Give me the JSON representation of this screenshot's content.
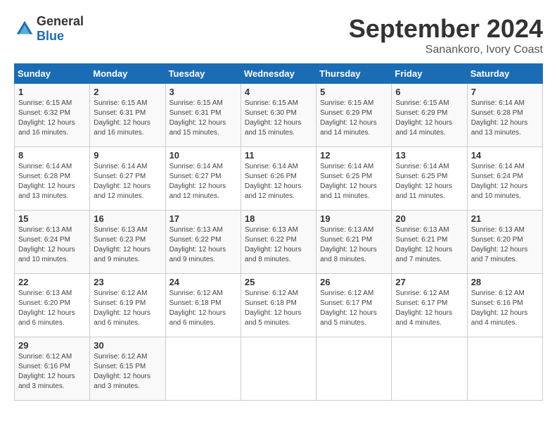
{
  "header": {
    "logo_line1": "General",
    "logo_line2": "Blue",
    "month": "September 2024",
    "location": "Sanankoro, Ivory Coast"
  },
  "days_of_week": [
    "Sunday",
    "Monday",
    "Tuesday",
    "Wednesday",
    "Thursday",
    "Friday",
    "Saturday"
  ],
  "weeks": [
    [
      {
        "day": "1",
        "info": "Sunrise: 6:15 AM\nSunset: 6:32 PM\nDaylight: 12 hours\nand 16 minutes."
      },
      {
        "day": "2",
        "info": "Sunrise: 6:15 AM\nSunset: 6:31 PM\nDaylight: 12 hours\nand 16 minutes."
      },
      {
        "day": "3",
        "info": "Sunrise: 6:15 AM\nSunset: 6:31 PM\nDaylight: 12 hours\nand 15 minutes."
      },
      {
        "day": "4",
        "info": "Sunrise: 6:15 AM\nSunset: 6:30 PM\nDaylight: 12 hours\nand 15 minutes."
      },
      {
        "day": "5",
        "info": "Sunrise: 6:15 AM\nSunset: 6:29 PM\nDaylight: 12 hours\nand 14 minutes."
      },
      {
        "day": "6",
        "info": "Sunrise: 6:15 AM\nSunset: 6:29 PM\nDaylight: 12 hours\nand 14 minutes."
      },
      {
        "day": "7",
        "info": "Sunrise: 6:14 AM\nSunset: 6:28 PM\nDaylight: 12 hours\nand 13 minutes."
      }
    ],
    [
      {
        "day": "8",
        "info": "Sunrise: 6:14 AM\nSunset: 6:28 PM\nDaylight: 12 hours\nand 13 minutes."
      },
      {
        "day": "9",
        "info": "Sunrise: 6:14 AM\nSunset: 6:27 PM\nDaylight: 12 hours\nand 12 minutes."
      },
      {
        "day": "10",
        "info": "Sunrise: 6:14 AM\nSunset: 6:27 PM\nDaylight: 12 hours\nand 12 minutes."
      },
      {
        "day": "11",
        "info": "Sunrise: 6:14 AM\nSunset: 6:26 PM\nDaylight: 12 hours\nand 12 minutes."
      },
      {
        "day": "12",
        "info": "Sunrise: 6:14 AM\nSunset: 6:25 PM\nDaylight: 12 hours\nand 11 minutes."
      },
      {
        "day": "13",
        "info": "Sunrise: 6:14 AM\nSunset: 6:25 PM\nDaylight: 12 hours\nand 11 minutes."
      },
      {
        "day": "14",
        "info": "Sunrise: 6:14 AM\nSunset: 6:24 PM\nDaylight: 12 hours\nand 10 minutes."
      }
    ],
    [
      {
        "day": "15",
        "info": "Sunrise: 6:13 AM\nSunset: 6:24 PM\nDaylight: 12 hours\nand 10 minutes."
      },
      {
        "day": "16",
        "info": "Sunrise: 6:13 AM\nSunset: 6:23 PM\nDaylight: 12 hours\nand 9 minutes."
      },
      {
        "day": "17",
        "info": "Sunrise: 6:13 AM\nSunset: 6:22 PM\nDaylight: 12 hours\nand 9 minutes."
      },
      {
        "day": "18",
        "info": "Sunrise: 6:13 AM\nSunset: 6:22 PM\nDaylight: 12 hours\nand 8 minutes."
      },
      {
        "day": "19",
        "info": "Sunrise: 6:13 AM\nSunset: 6:21 PM\nDaylight: 12 hours\nand 8 minutes."
      },
      {
        "day": "20",
        "info": "Sunrise: 6:13 AM\nSunset: 6:21 PM\nDaylight: 12 hours\nand 7 minutes."
      },
      {
        "day": "21",
        "info": "Sunrise: 6:13 AM\nSunset: 6:20 PM\nDaylight: 12 hours\nand 7 minutes."
      }
    ],
    [
      {
        "day": "22",
        "info": "Sunrise: 6:13 AM\nSunset: 6:20 PM\nDaylight: 12 hours\nand 6 minutes."
      },
      {
        "day": "23",
        "info": "Sunrise: 6:12 AM\nSunset: 6:19 PM\nDaylight: 12 hours\nand 6 minutes."
      },
      {
        "day": "24",
        "info": "Sunrise: 6:12 AM\nSunset: 6:18 PM\nDaylight: 12 hours\nand 6 minutes."
      },
      {
        "day": "25",
        "info": "Sunrise: 6:12 AM\nSunset: 6:18 PM\nDaylight: 12 hours\nand 5 minutes."
      },
      {
        "day": "26",
        "info": "Sunrise: 6:12 AM\nSunset: 6:17 PM\nDaylight: 12 hours\nand 5 minutes."
      },
      {
        "day": "27",
        "info": "Sunrise: 6:12 AM\nSunset: 6:17 PM\nDaylight: 12 hours\nand 4 minutes."
      },
      {
        "day": "28",
        "info": "Sunrise: 6:12 AM\nSunset: 6:16 PM\nDaylight: 12 hours\nand 4 minutes."
      }
    ],
    [
      {
        "day": "29",
        "info": "Sunrise: 6:12 AM\nSunset: 6:16 PM\nDaylight: 12 hours\nand 3 minutes."
      },
      {
        "day": "30",
        "info": "Sunrise: 6:12 AM\nSunset: 6:15 PM\nDaylight: 12 hours\nand 3 minutes."
      },
      null,
      null,
      null,
      null,
      null
    ]
  ]
}
